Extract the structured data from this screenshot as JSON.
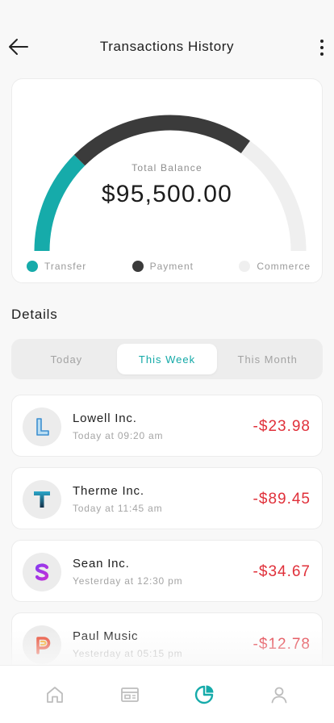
{
  "header": {
    "title": "Transactions History"
  },
  "balance": {
    "label": "Total Balance",
    "value": "$95,500.00",
    "segments": [
      {
        "name": "Transfer",
        "color": "#16abaa",
        "fraction": 0.25
      },
      {
        "name": "Payment",
        "color": "#3b3b3b",
        "fraction": 0.45
      },
      {
        "name": "Commerce",
        "color": "#efefef",
        "fraction": 0.3
      }
    ]
  },
  "details": {
    "title": "Details",
    "tabs": [
      "Today",
      "This Week",
      "This Month"
    ],
    "active_tab": "This Week"
  },
  "transactions": [
    {
      "name": "Lowell Inc.",
      "time": "Today at 09:20 am",
      "amount": "-$23.98",
      "icon": "lowell-logo-icon"
    },
    {
      "name": "Therme Inc.",
      "time": "Today at 11:45 am",
      "amount": "-$89.45",
      "icon": "therme-logo-icon"
    },
    {
      "name": "Sean Inc.",
      "time": "Yesterday at 12:30 pm",
      "amount": "-$34.67",
      "icon": "sean-logo-icon"
    },
    {
      "name": "Paul Music",
      "time": "Yesterday at 05:15 pm",
      "amount": "-$12.78",
      "icon": "paul-music-logo-icon"
    }
  ],
  "colors": {
    "accent": "#16abaa",
    "negative": "#e0303a",
    "nav_inactive": "#bdbdbd"
  },
  "nav": {
    "items": [
      "home-icon",
      "wallet-icon",
      "chart-pie-icon",
      "profile-icon"
    ],
    "active": "chart-pie-icon"
  }
}
